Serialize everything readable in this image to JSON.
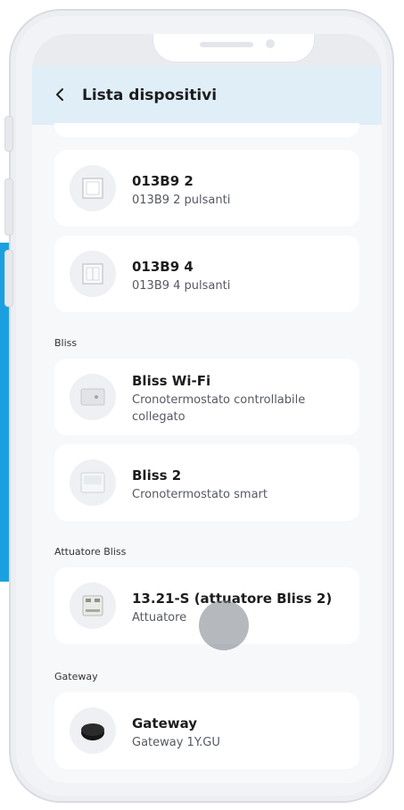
{
  "header": {
    "title": "Lista dispositivi"
  },
  "sections": [
    {
      "label": "Bliss"
    },
    {
      "label": "Attuatore Bliss"
    },
    {
      "label": "Gateway"
    }
  ],
  "devices": [
    {
      "name": "013B9 2",
      "description": "013B9 2 pulsanti",
      "icon": "switch-2-icon"
    },
    {
      "name": "013B9 4",
      "description": "013B9 4 pulsanti",
      "icon": "switch-4-icon"
    },
    {
      "name": "Bliss Wi-Fi",
      "description": "Cronotermostato controllabile collegato",
      "icon": "thermostat-wifi-icon"
    },
    {
      "name": "Bliss 2",
      "description": "Cronotermostato smart",
      "icon": "thermostat-icon"
    },
    {
      "name": "13.21-S (attuatore Bliss 2)",
      "description": "Attuatore",
      "icon": "actuator-icon"
    },
    {
      "name": "Gateway",
      "description": "Gateway 1Y.GU",
      "icon": "gateway-icon"
    }
  ],
  "colors": {
    "header_bg": "#dfeef7",
    "accent": "#1aa0e0"
  }
}
